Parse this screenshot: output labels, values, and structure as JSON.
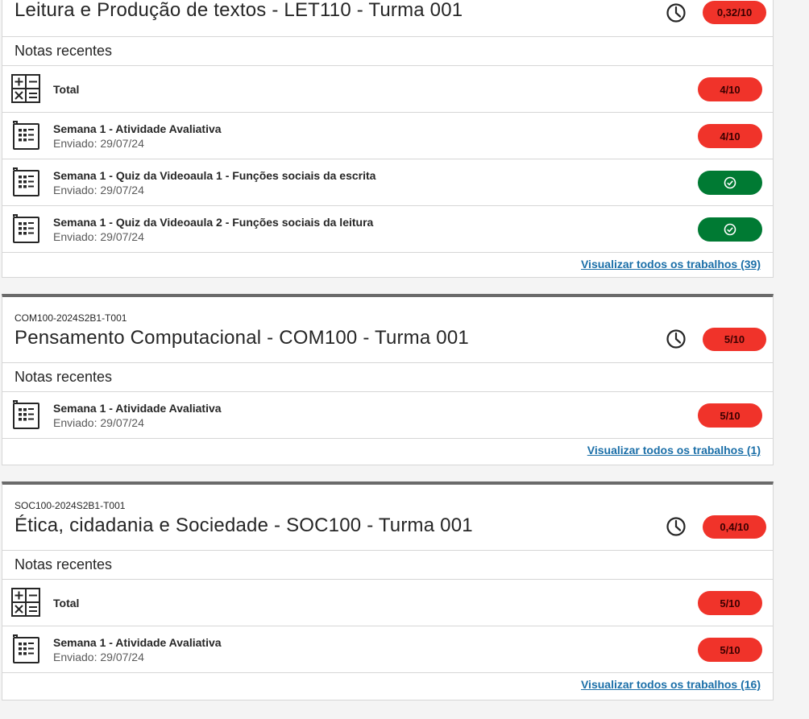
{
  "colors": {
    "grade_bad": "#f0332a",
    "grade_ok": "#007a33",
    "link": "#1b6fa8"
  },
  "courses": [
    {
      "code": "",
      "title": "Leitura e Produção de textos - LET110 - Turma 001",
      "overall_grade": "0,32/10",
      "section_label": "Notas recentes",
      "items": [
        {
          "icon": "calculator-icon",
          "title": "Total",
          "subtitle": "",
          "grade": "4/10",
          "status": "bad"
        },
        {
          "icon": "assignment-doc-icon",
          "title": "Semana 1 - Atividade Avaliativa",
          "subtitle": "Enviado: 29/07/24",
          "grade": "4/10",
          "status": "bad"
        },
        {
          "icon": "assignment-doc-icon",
          "title": "Semana 1 - Quiz da Videoaula 1 - Funções sociais da escrita",
          "subtitle": "Enviado: 29/07/24",
          "grade": "check-icon",
          "status": "ok"
        },
        {
          "icon": "assignment-doc-icon",
          "title": "Semana 1 - Quiz da Videoaula 2 - Funções sociais da leitura",
          "subtitle": "Enviado: 29/07/24",
          "grade": "check-icon",
          "status": "ok"
        }
      ],
      "view_all": "Visualizar todos os trabalhos (39)"
    },
    {
      "code": "COM100-2024S2B1-T001",
      "title": "Pensamento Computacional - COM100 - Turma 001",
      "overall_grade": "5/10",
      "section_label": "Notas recentes",
      "items": [
        {
          "icon": "assignment-doc-icon",
          "title": "Semana 1 - Atividade Avaliativa",
          "subtitle": "Enviado: 29/07/24",
          "grade": "5/10",
          "status": "bad"
        }
      ],
      "view_all": "Visualizar todos os trabalhos (1)"
    },
    {
      "code": "SOC100-2024S2B1-T001",
      "title": "Ética, cidadania e Sociedade - SOC100 - Turma 001",
      "overall_grade": "0,4/10",
      "section_label": "Notas recentes",
      "items": [
        {
          "icon": "calculator-icon",
          "title": "Total",
          "subtitle": "",
          "grade": "5/10",
          "status": "bad"
        },
        {
          "icon": "assignment-doc-icon",
          "title": "Semana 1 - Atividade Avaliativa",
          "subtitle": "Enviado: 29/07/24",
          "grade": "5/10",
          "status": "bad"
        }
      ],
      "view_all": "Visualizar todos os trabalhos (16)"
    }
  ]
}
